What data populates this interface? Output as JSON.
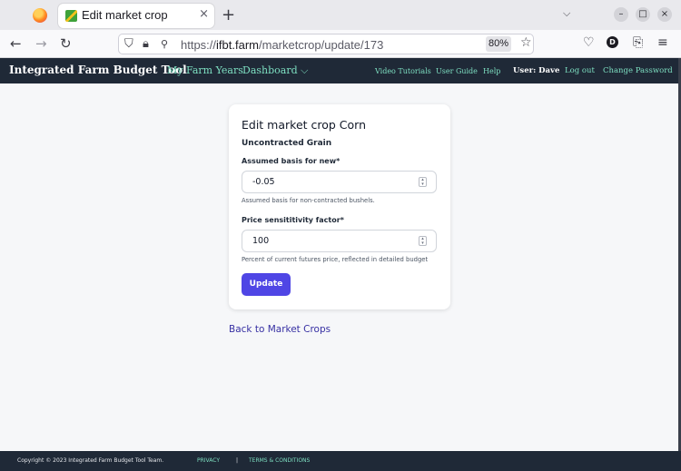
{
  "browser": {
    "tab_title": "Edit market crop",
    "tab_close": "×",
    "new_tab": "+",
    "url_scheme": "https://",
    "url_host": "ifbt.farm",
    "url_path": "/marketcrop/update/173",
    "zoom": "80%",
    "profile_initial": "D",
    "win_minimize": "–",
    "win_maximize": "□",
    "win_close": "×"
  },
  "header": {
    "brand": "Integrated Farm Budget Tool",
    "nav_farm_years": "My Farm Years",
    "nav_dashboard": "Dashboard",
    "dashboard_chevron": "⌵",
    "video_tutorials": "Video Tutorials",
    "user_guide": "User Guide",
    "help": "Help",
    "user": "User: Dave",
    "logout": "Log out",
    "change_password": "Change Password"
  },
  "form": {
    "title": "Edit market crop Corn",
    "section": "Uncontracted Grain",
    "basis_label": "Assumed basis for new*",
    "basis_value": "-0.05",
    "basis_help": "Assumed basis for non-contracted bushels.",
    "price_label": "Price sensititivity factor*",
    "price_value": "100",
    "price_help": "Percent of current futures price, reflected in detailed budget",
    "submit": "Update"
  },
  "back_link": "Back to Market Crops",
  "footer": {
    "copyright": "Copyright © 2023 Integrated Farm Budget Tool Team.",
    "privacy": "PRIVACY",
    "separator": "|",
    "terms": "TERMS & CONDITIONS"
  }
}
